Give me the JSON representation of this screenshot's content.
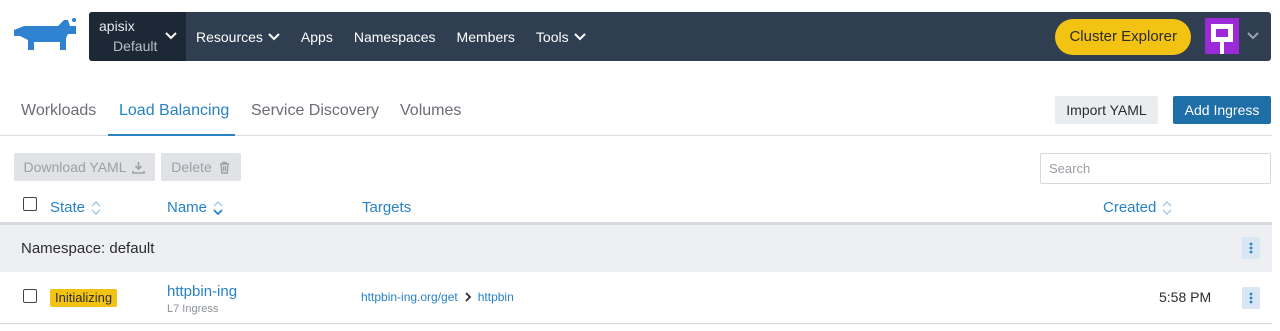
{
  "topnav": {
    "cluster_name": "apisix",
    "project_name": "Default",
    "items": [
      {
        "label": "Resources",
        "has_dropdown": true
      },
      {
        "label": "Apps",
        "has_dropdown": false
      },
      {
        "label": "Namespaces",
        "has_dropdown": false
      },
      {
        "label": "Members",
        "has_dropdown": false
      },
      {
        "label": "Tools",
        "has_dropdown": true
      }
    ],
    "cluster_explorer_label": "Cluster Explorer",
    "colors": {
      "nav_bg": "#2f3e51",
      "cluster_bg": "#1d2837",
      "accent_yellow": "#f3c313",
      "avatar": "#9b2bd8"
    }
  },
  "tabs": {
    "items": [
      "Workloads",
      "Load Balancing",
      "Service Discovery",
      "Volumes"
    ],
    "active": "Load Balancing",
    "import_yaml_label": "Import YAML",
    "add_ingress_label": "Add Ingress",
    "colors": {
      "active": "#2782c6",
      "primary_button": "#1e6ea7"
    }
  },
  "toolbar": {
    "download_label": "Download YAML",
    "delete_label": "Delete",
    "search_placeholder": "Search"
  },
  "table": {
    "columns": {
      "state": "State",
      "name": "Name",
      "targets": "Targets",
      "created": "Created"
    },
    "group_label": "Namespace: default",
    "rows": [
      {
        "state": "Initializing",
        "name": "httpbin-ing",
        "subtitle": "L7 Ingress",
        "target_from": "httpbin-ing.org/get",
        "target_to": "httpbin",
        "created": "5:58 PM"
      }
    ]
  }
}
